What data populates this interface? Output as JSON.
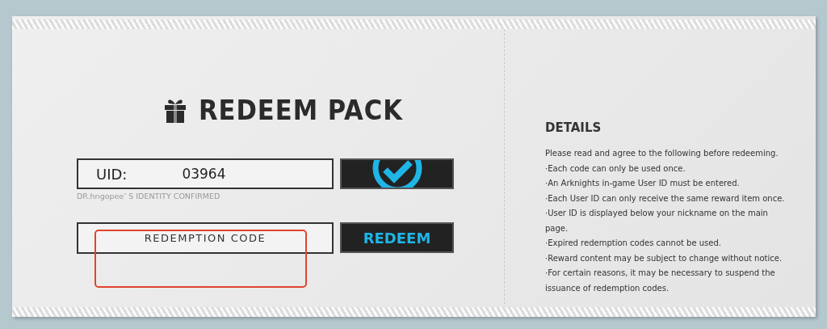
{
  "title": "REDEEM PACK",
  "uid": {
    "label": "UID:",
    "value": "03964",
    "confirmed": true,
    "status": "DR.hngopee’  S IDENTITY CONFIRMED"
  },
  "code": {
    "placeholder": "REDEMPTION CODE",
    "highlighted": true
  },
  "redeem_button": "REDEEM",
  "details": {
    "title": "DETAILS",
    "intro": "Please read and agree to the following before redeeming.",
    "items": [
      "·Each code can only be used once.",
      "·An Arknights in-game User ID must be entered.",
      "·Each User ID can only receive the same reward item once.",
      "·User ID is displayed below your nickname on the main page.",
      "·Expired redemption codes cannot be used.",
      "·Reward content may be subject to change without notice.",
      "·For certain reasons, it may be necessary to suspend the issuance of redemption codes."
    ]
  }
}
